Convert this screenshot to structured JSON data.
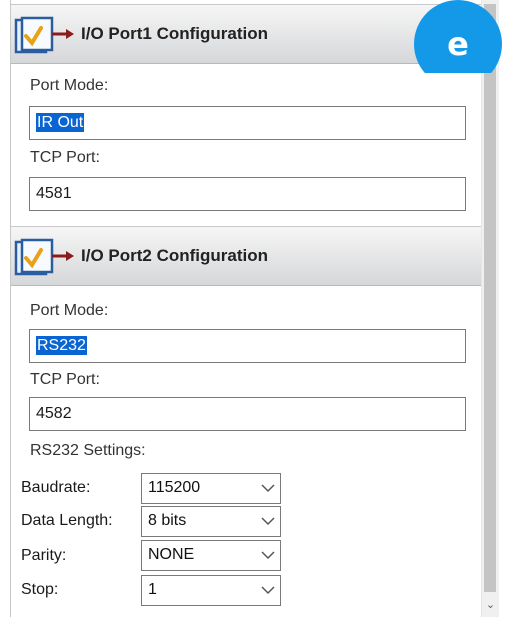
{
  "badge": {
    "letter": "e",
    "color": "#1499e8"
  },
  "port1": {
    "title": "I/O Port1 Configuration",
    "icon": "config-checklist-icon",
    "port_mode_label": "Port Mode:",
    "port_mode_value": "IR Out",
    "tcp_port_label": "TCP Port:",
    "tcp_port_value": "4581"
  },
  "port2": {
    "title": "I/O Port2 Configuration",
    "icon": "config-checklist-icon",
    "port_mode_label": "Port Mode:",
    "port_mode_value": "RS232",
    "tcp_port_label": "TCP Port:",
    "tcp_port_value": "4582",
    "rs232_settings_label": "RS232 Settings:",
    "baudrate": {
      "label": "Baudrate:",
      "value": "115200"
    },
    "data_length": {
      "label": "Data Length:",
      "value": "8 bits"
    },
    "parity": {
      "label": "Parity:",
      "value": "NONE"
    },
    "stop": {
      "label": "Stop:",
      "value": "1"
    }
  },
  "colors": {
    "selection": "#0a64d2",
    "header_gradient_top": "#f6f6f6",
    "header_gradient_bottom": "#d6d7d9"
  }
}
